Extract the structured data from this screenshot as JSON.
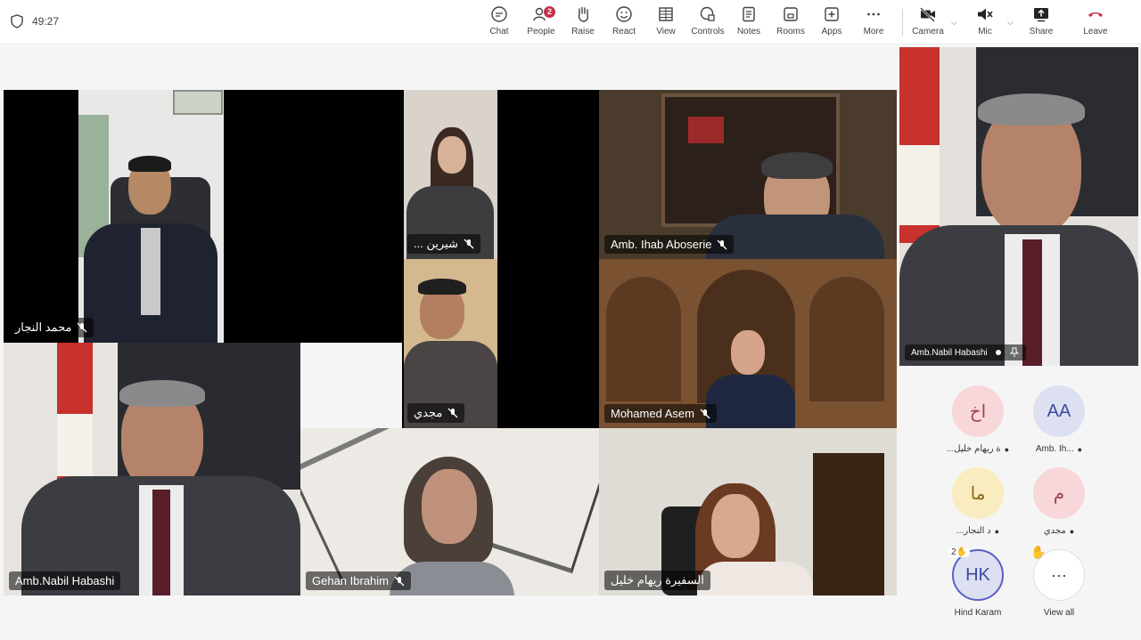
{
  "meeting": {
    "timer": "49:27"
  },
  "toolbar": {
    "chat": "Chat",
    "people": "People",
    "people_badge": "2",
    "raise": "Raise",
    "react": "React",
    "view": "View",
    "controls": "Controls",
    "notes": "Notes",
    "rooms": "Rooms",
    "apps": "Apps",
    "more": "More",
    "camera": "Camera",
    "mic": "Mic",
    "share": "Share",
    "leave": "Leave"
  },
  "tiles": {
    "t1": "محمد النجار",
    "t2": "... شيرين",
    "t3": "Amb. Ihab Aboserie",
    "t4": "مجدي",
    "t5": "Mohamed Asem",
    "t6": "Amb.Nabil Habashi",
    "t7": "Gehan Ibrahim",
    "t8": "السفيرة ريهام خليل",
    "pinned": "Amb.Nabil Habashi"
  },
  "roster": [
    {
      "initials": "اخ",
      "name": "...ة ريهام خليل"
    },
    {
      "initials": "AA",
      "name": "Amb. Ih..."
    },
    {
      "initials": "ما",
      "name": "...د النجار"
    },
    {
      "initials": "م",
      "name": "مجدي"
    },
    {
      "initials": "HK",
      "name": "Hind Karam",
      "raise_count": "2"
    },
    {
      "initials": "···",
      "name": "View all"
    }
  ],
  "colors": {
    "leave_red": "#c4314b",
    "avatar_pink": "#f7d7d9",
    "avatar_lilac": "#dde0f1",
    "avatar_yellow": "#f9ecc0"
  }
}
